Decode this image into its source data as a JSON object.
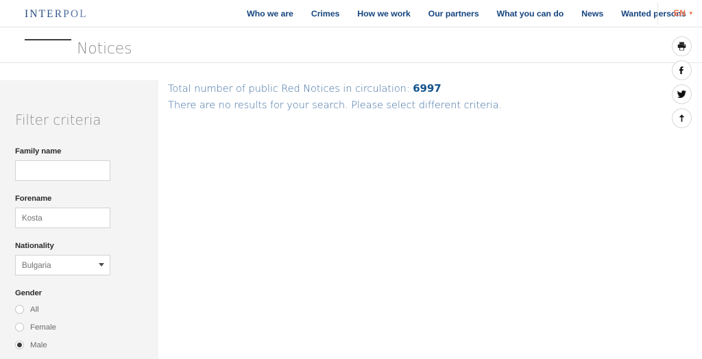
{
  "header": {
    "logo_text": "INTERPOL",
    "nav": [
      {
        "label": "Who we are"
      },
      {
        "label": "Crimes"
      },
      {
        "label": "How we work"
      },
      {
        "label": "Our partners"
      },
      {
        "label": "What you can do"
      },
      {
        "label": "News"
      },
      {
        "label": "Wanted persons"
      }
    ],
    "language": {
      "label": "EN",
      "chevron": "▾",
      "color": "#f0744d"
    }
  },
  "page": {
    "title": "Notices"
  },
  "sidebar": {
    "heading": "Filter criteria",
    "fields": {
      "family_name": {
        "label": "Family name",
        "value": "",
        "placeholder": ""
      },
      "forename": {
        "label": "Forename",
        "value": "Kosta",
        "placeholder": ""
      },
      "nationality": {
        "label": "Nationality",
        "value": "Bulgaria"
      }
    },
    "gender": {
      "label": "Gender",
      "options": [
        {
          "label": "All",
          "selected": false
        },
        {
          "label": "Female",
          "selected": false
        },
        {
          "label": "Male",
          "selected": true
        }
      ]
    }
  },
  "main": {
    "total_prefix": "Total number of public Red Notices in circulation: ",
    "total_count": "6997",
    "no_results": "There are no results for your search. Please select different criteria."
  },
  "social_rail": [
    {
      "name": "print-icon",
      "title": "Print"
    },
    {
      "name": "facebook-icon",
      "title": "Facebook"
    },
    {
      "name": "twitter-icon",
      "title": "Twitter"
    },
    {
      "name": "scroll-to-top-icon",
      "title": "Back to top"
    }
  ]
}
